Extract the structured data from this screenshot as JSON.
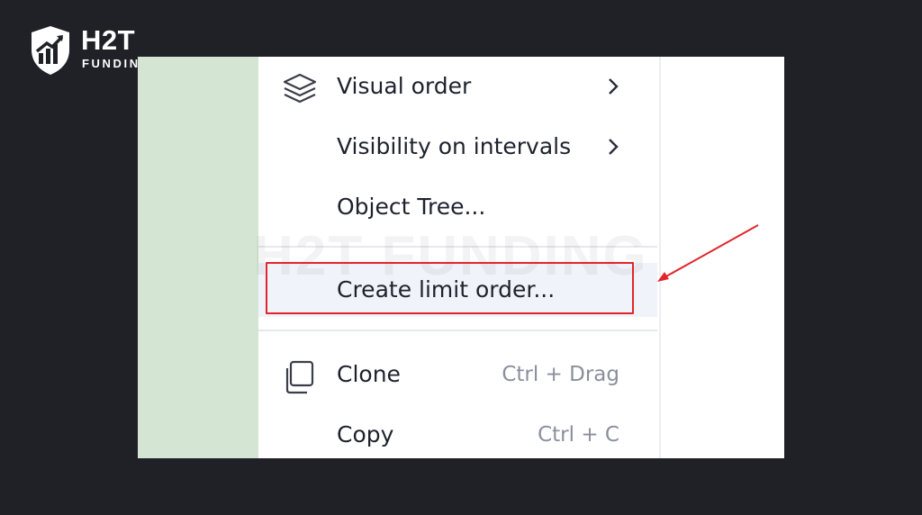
{
  "brand": {
    "name": "H2T",
    "tagline": "FUNDING",
    "watermark": "H2T FUNDING"
  },
  "colors": {
    "page_background": "#202126",
    "chart_background": "#d4e6d3",
    "menu_background": "#ffffff",
    "menu_highlight": "#f0f3fa",
    "annotation_red": "#e1262b"
  },
  "context_menu": {
    "items": [
      {
        "label": "Visual order",
        "icon": "layers-icon",
        "has_submenu": true
      },
      {
        "label": "Visibility on intervals",
        "has_submenu": true
      },
      {
        "label": "Object Tree..."
      },
      {
        "label": "Create limit order...",
        "highlighted": true
      },
      {
        "label": "Clone",
        "icon": "clone-icon",
        "shortcut": "Ctrl + Drag"
      },
      {
        "label": "Copy",
        "shortcut": "Ctrl + C"
      }
    ]
  },
  "annotation": {
    "type": "red-box-with-arrow",
    "target": "Create limit order..."
  }
}
